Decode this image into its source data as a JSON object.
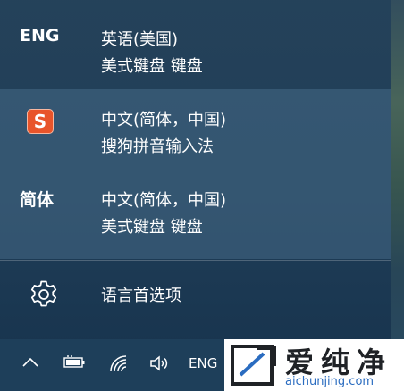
{
  "flyout": {
    "items": [
      {
        "badge": "ENG",
        "line1": "英语(美国)",
        "line2": "美式键盘 键盘"
      },
      {
        "badge_icon": "sogou-icon",
        "badge": "S",
        "line1": "中文(简体，中国)",
        "line2": "搜狗拼音输入法"
      },
      {
        "badge": "简体",
        "line1": "中文(简体，中国)",
        "line2": "美式键盘 键盘"
      }
    ],
    "preferences_label": "语言首选项",
    "preferences_icon": "gear-icon"
  },
  "taskbar": {
    "icons": [
      "chevron-up-icon",
      "battery-icon",
      "wifi-icon",
      "speaker-icon"
    ],
    "language_indicator": "ENG"
  },
  "watermark": {
    "title": "爱纯净",
    "url": "aichunjing.com"
  },
  "colors": {
    "flyout_bg": "#23435e",
    "selected_bg": "#466987",
    "sogou_orange": "#e8542a",
    "watermark_url": "#2a6cc0"
  }
}
